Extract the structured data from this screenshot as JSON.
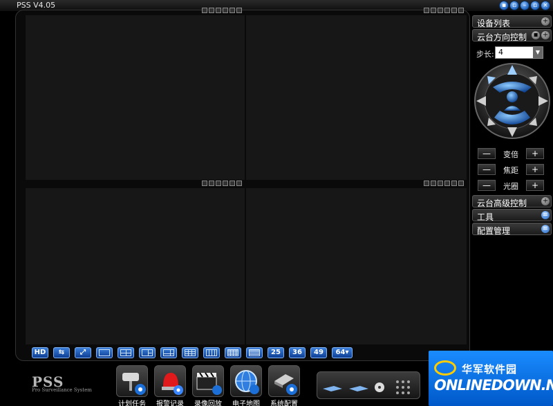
{
  "window": {
    "title": "PSS  V4.05",
    "buttons": [
      "lock-icon",
      "page-icon",
      "minimize-icon",
      "restore-icon",
      "close-icon"
    ]
  },
  "layout_buttons": [
    {
      "label": "HD",
      "icon": "hd-icon"
    },
    {
      "label": "",
      "icon": "sequence-icon"
    },
    {
      "label": "",
      "icon": "fullscreen-icon"
    },
    {
      "label": "",
      "icon": "layout-1-icon"
    },
    {
      "label": "",
      "icon": "layout-4-icon"
    },
    {
      "label": "",
      "icon": "layout-6-icon"
    },
    {
      "label": "",
      "icon": "layout-8-icon"
    },
    {
      "label": "",
      "icon": "layout-9-icon"
    },
    {
      "label": "",
      "icon": "layout-13-icon"
    },
    {
      "label": "",
      "icon": "layout-16-icon"
    },
    {
      "label": "",
      "icon": "layout-20-icon"
    },
    {
      "label": "25",
      "icon": ""
    },
    {
      "label": "36",
      "icon": ""
    },
    {
      "label": "49",
      "icon": ""
    },
    {
      "label": "64▾",
      "icon": ""
    }
  ],
  "right_panel": {
    "device_list": "设备列表",
    "ptz_control": "云台方向控制",
    "step_label": "步长:",
    "step_value": "4",
    "zoom_label": "变倍",
    "focus_label": "焦距",
    "iris_label": "光圈",
    "minus": "—",
    "plus": "+",
    "ptz_advanced": "云台高级控制",
    "tools": "工具",
    "config": "配置管理"
  },
  "bottom": {
    "logo": "PSS",
    "logo_sub": "Pro Surveillance System",
    "functions": [
      {
        "label": "计划任务",
        "icon": "camera-schedule-icon"
      },
      {
        "label": "报警记录",
        "icon": "alarm-siren-icon"
      },
      {
        "label": "录像回放",
        "icon": "clapperboard-icon"
      },
      {
        "label": "电子地图",
        "icon": "globe-map-icon"
      },
      {
        "label": "系统配置",
        "icon": "system-config-icon"
      }
    ]
  },
  "watermark": {
    "cn": "华军软件园",
    "en": "ONLINEDOWN.NET"
  },
  "colors": {
    "accent_blue": "#1d5fb8",
    "panel_bg": "#171717",
    "watermark_blue": "#0a70e0"
  }
}
